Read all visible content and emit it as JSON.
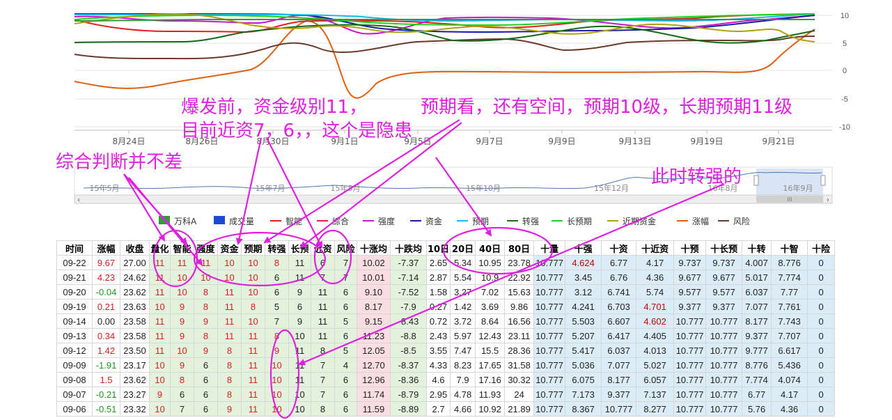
{
  "chart": {
    "y_ticks": [
      "10",
      "5",
      "0",
      "-5",
      "-10"
    ],
    "x_dates": [
      "8月24日",
      "8月26日",
      "8月30日",
      "9月1日",
      "9月5日",
      "9月7日",
      "9月9日",
      "9月13日",
      "9月19日",
      "9月21日"
    ],
    "nav_dates": [
      "15年5月",
      "15年7月",
      "15年8月",
      "15年10月",
      "15年12月",
      "16年8月",
      "16年9月"
    ],
    "scroll_left": "‹",
    "scroll_right": "›",
    "scroll_grip": "III"
  },
  "legend": [
    {
      "label": "万科A",
      "color": "#2e9a3a",
      "kind": "box"
    },
    {
      "label": "成交量",
      "color": "#1e4ad0",
      "kind": "box"
    },
    {
      "label": "智能",
      "color": "#e0201c",
      "kind": "line"
    },
    {
      "label": "综合",
      "color": "#e02040",
      "kind": "line"
    },
    {
      "label": "强度",
      "color": "#d010d0",
      "kind": "line"
    },
    {
      "label": "资金",
      "color": "#1a1aa8",
      "kind": "line"
    },
    {
      "label": "预期",
      "color": "#18b8e8",
      "kind": "line"
    },
    {
      "label": "转强",
      "color": "#126a12",
      "kind": "line"
    },
    {
      "label": "长预期",
      "color": "#22d022",
      "kind": "line"
    },
    {
      "label": "近期资金",
      "color": "#b0a010",
      "kind": "line"
    },
    {
      "label": "涨幅",
      "color": "#e06010",
      "kind": "line"
    },
    {
      "label": "风险",
      "color": "#6a3a2a",
      "kind": "line"
    }
  ],
  "table": {
    "headers": [
      "时间",
      "涨幅",
      "收盘",
      "量化",
      "智能",
      "强度",
      "资金",
      "预期",
      "转强",
      "长预",
      "近资",
      "风险",
      "十涨均",
      "十跌均",
      "10日",
      "20日",
      "40日",
      "80日",
      "十量",
      "十强",
      "十资",
      "十近资",
      "十预",
      "十长预",
      "十转",
      "十智",
      "十险"
    ],
    "rows": [
      [
        "09-22",
        "9.67",
        "27.00",
        "11",
        "11",
        "11",
        "10",
        "10",
        "8",
        "11",
        "6",
        "7",
        "10.02",
        "-7.37",
        "2.65",
        "5.34",
        "10.95",
        "23.78",
        "10.777",
        "4.624",
        "6.77",
        "4.17",
        "9.737",
        "9.737",
        "4.007",
        "8.776",
        "0"
      ],
      [
        "09-21",
        "4.23",
        "24.62",
        "11",
        "10",
        "10",
        "10",
        "10",
        "6",
        "11",
        "7",
        "7",
        "10.01",
        "-7.14",
        "2.87",
        "5.54",
        "10.9",
        "22.92",
        "10.777",
        "3.45",
        "6.76",
        "4.36",
        "9.677",
        "9.677",
        "5.017",
        "7.774",
        "0"
      ],
      [
        "09-20",
        "-0.04",
        "23.62",
        "11",
        "10",
        "8",
        "11",
        "10",
        "6",
        "9",
        "11",
        "6",
        "9.10",
        "-7.52",
        "1.58",
        "3.27",
        "7.02",
        "15.63",
        "10.777",
        "3.12",
        "6.741",
        "5.74",
        "9.577",
        "9.577",
        "6.037",
        "7.77",
        "0"
      ],
      [
        "09-19",
        "0.21",
        "23.63",
        "10",
        "9",
        "8",
        "11",
        "8",
        "5",
        "6",
        "11",
        "6",
        "8.17",
        "-7.9",
        "0.27",
        "1.42",
        "3.69",
        "9.86",
        "10.777",
        "4.241",
        "6.703",
        "4.701",
        "9.377",
        "9.377",
        "7.077",
        "7.761",
        "0"
      ],
      [
        "09-14",
        "0.00",
        "23.58",
        "11",
        "9",
        "9",
        "11",
        "10",
        "7",
        "9",
        "11",
        "5",
        "9.15",
        "-8.43",
        "0.72",
        "3.72",
        "8.64",
        "16.56",
        "10.777",
        "5.503",
        "6.607",
        "4.602",
        "10.777",
        "10.777",
        "8.177",
        "7.743",
        "0"
      ],
      [
        "09-13",
        "0.34",
        "23.58",
        "11",
        "9",
        "8",
        "11",
        "11",
        "8",
        "10",
        "11",
        "6",
        "11.23",
        "-8.8",
        "2.43",
        "5.97",
        "12.43",
        "23.11",
        "10.777",
        "5.207",
        "6.417",
        "4.405",
        "10.777",
        "10.777",
        "9.377",
        "7.707",
        "0"
      ],
      [
        "09-12",
        "1.42",
        "23.50",
        "11",
        "10",
        "9",
        "8",
        "11",
        "9",
        "11",
        "8",
        "5",
        "12.05",
        "-8.5",
        "3.55",
        "7.47",
        "15.5",
        "28.36",
        "10.777",
        "5.417",
        "6.037",
        "4.013",
        "10.777",
        "10.777",
        "9.777",
        "6.617",
        "0"
      ],
      [
        "09-09",
        "-1.91",
        "23.17",
        "10",
        "9",
        "6",
        "8",
        "11",
        "10",
        "11",
        "7",
        "4",
        "12.70",
        "-8.37",
        "4.33",
        "8.23",
        "17.65",
        "31.58",
        "10.777",
        "5.036",
        "7.077",
        "5.027",
        "10.777",
        "10.777",
        "8.776",
        "5.436",
        "0"
      ],
      [
        "09-08",
        "1.5",
        "23.62",
        "10",
        "8",
        "6",
        "8",
        "11",
        "10",
        "11",
        "7",
        "6",
        "12.96",
        "-8.36",
        "4.6",
        "7.9",
        "17.16",
        "30.32",
        "10.777",
        "6.075",
        "8.177",
        "6.057",
        "10.777",
        "10.777",
        "7.774",
        "4.074",
        "0"
      ],
      [
        "09-07",
        "-0.21",
        "23.27",
        "9",
        "6",
        "6",
        "8",
        "11",
        "10",
        "10",
        "7",
        "6",
        "11.74",
        "-8.79",
        "2.95",
        "4.78",
        "11.93",
        "24",
        "10.777",
        "7.173",
        "9.377",
        "7.137",
        "10.777",
        "10.777",
        "6.77",
        "4.17",
        "0"
      ],
      [
        "09-06",
        "-0.51",
        "23.32",
        "10",
        "7",
        "6",
        "9",
        "11",
        "10",
        "10",
        "8",
        "6",
        "11.59",
        "-8.89",
        "2.7",
        "4.66",
        "10.92",
        "21.89",
        "10.777",
        "8.367",
        "10.777",
        "8.277",
        "10.777",
        "10.777",
        "5.76",
        "4.36",
        "0"
      ]
    ]
  },
  "annotations": {
    "a1": "爆发前，资金级别11，",
    "a2": "预期看，还有空间，预期10级，长期预期11级",
    "a3": "目前近资7，6，，这个是隐患",
    "a4": "综合判断并不差",
    "a5": "此时转强的"
  },
  "colors": {
    "annotation": "#e020e0",
    "up": "#d62020",
    "down": "#1a9a1a"
  }
}
